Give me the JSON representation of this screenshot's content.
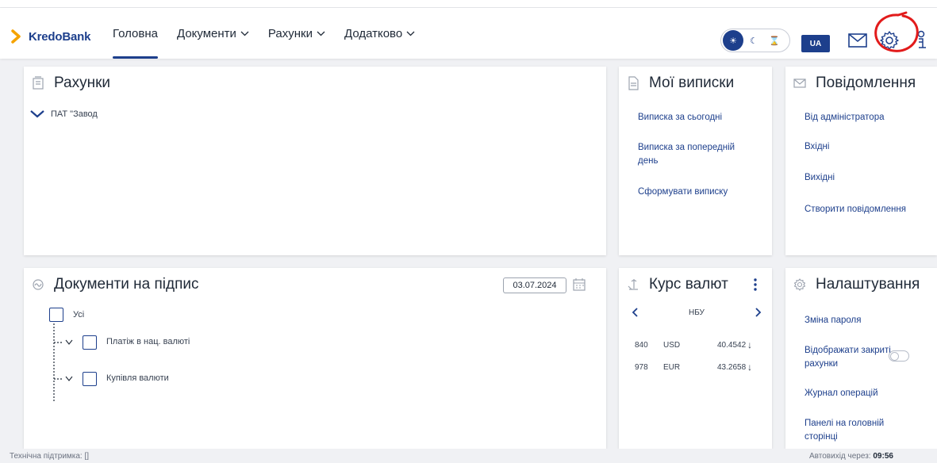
{
  "brand": {
    "name": "KredoBank",
    "accent": "#1d3f8c",
    "logo_color": "#f5a300"
  },
  "nav": {
    "home": "Головна",
    "documents": "Документи",
    "accounts": "Рахунки",
    "additional": "Додатково"
  },
  "header": {
    "lang": "UA"
  },
  "accounts_card": {
    "title": "Рахунки",
    "group": "ПАТ \"Завод"
  },
  "statements_card": {
    "title": "Мої виписки",
    "items": [
      "Виписка за сьогодні",
      "Виписка за попередній день",
      "Сформувати виписку"
    ]
  },
  "messages_card": {
    "title": "Повідомлення",
    "items": [
      "Від адміністратора",
      "Вхідні",
      "Вихідні",
      "Створити повідомлення"
    ]
  },
  "signing_card": {
    "title": "Документи на підпис",
    "date": "03.07.2024",
    "all": "Усі",
    "types": [
      "Платіж в нац. валюті",
      "Купівля валюти"
    ]
  },
  "rates_card": {
    "title": "Курс валют",
    "source": "НБУ",
    "rates": [
      {
        "code": "840",
        "currency": "USD",
        "rate": "40.4542",
        "trend": "↓"
      },
      {
        "code": "978",
        "currency": "EUR",
        "rate": "43.2658",
        "trend": "↓"
      }
    ]
  },
  "settings_card": {
    "title": "Налаштування",
    "items": [
      "Зміна пароля",
      "Відображати закриті рахунки",
      "Журнал операцій",
      "Панелі на головній сторінці"
    ],
    "show_closed_accounts": false
  },
  "footer": {
    "support": "Технічна підтримка:",
    "support_mark": "[]",
    "logout_label": "Автовихід через:",
    "logout_time": "09:56"
  }
}
